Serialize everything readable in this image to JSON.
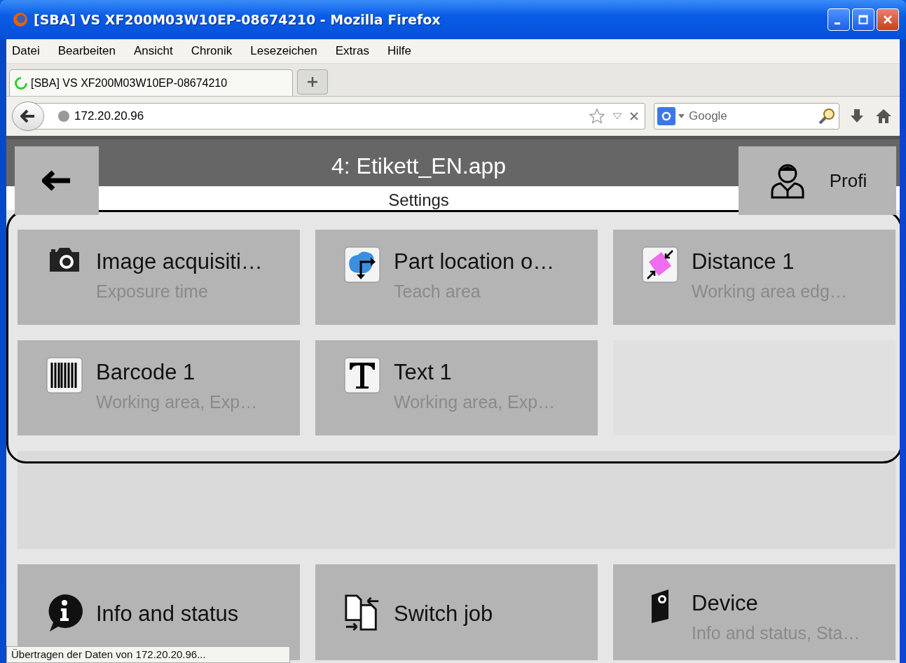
{
  "window": {
    "title": "[SBA] VS XF200M03W10EP-08674210 - Mozilla Firefox"
  },
  "menu": [
    "Datei",
    "Bearbeiten",
    "Ansicht",
    "Chronik",
    "Lesezeichen",
    "Extras",
    "Hilfe"
  ],
  "tabs": [
    {
      "label": "[SBA] VS XF200M03W10EP-08674210",
      "selected": true
    }
  ],
  "address_bar": {
    "value": "172.20.20.96"
  },
  "search": {
    "placeholder": "Google"
  },
  "app": {
    "title": "4: Etikett_EN.app",
    "user": "Profi",
    "subtitle": "Settings",
    "tiles": [
      {
        "kind": "camera",
        "title": "Image acquisiti…",
        "subtitle": "Exposure time"
      },
      {
        "kind": "location",
        "title": "Part location o…",
        "subtitle": "Teach area"
      },
      {
        "kind": "distance",
        "title": "Distance 1",
        "subtitle": "Working area edg…"
      },
      {
        "kind": "barcode",
        "title": "Barcode 1",
        "subtitle": "Working area, Exp…"
      },
      {
        "kind": "text",
        "title": "Text 1",
        "subtitle": "Working area, Exp…"
      }
    ],
    "bottom_tiles": [
      {
        "kind": "info",
        "title": "Info and status"
      },
      {
        "kind": "switch",
        "title": "Switch job"
      },
      {
        "kind": "device",
        "title": "Device",
        "subtitle": "Info and status, Sta…"
      }
    ]
  },
  "status_bar": "Übertragen der Daten von 172.20.20.96..."
}
